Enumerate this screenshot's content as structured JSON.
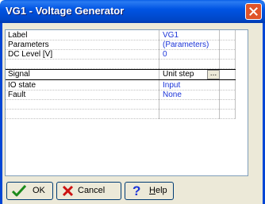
{
  "window": {
    "title": "VG1 - Voltage Generator",
    "close_icon": "close-icon"
  },
  "properties": [
    {
      "name": "Label",
      "value": "VG1"
    },
    {
      "name": "Parameters",
      "value": "(Parameters)"
    },
    {
      "name": "DC Level [V]",
      "value": "0"
    },
    {
      "name": "Signal",
      "value": "Unit step"
    },
    {
      "name": "IO state",
      "value": "Input"
    },
    {
      "name": "Fault",
      "value": "None"
    }
  ],
  "selected_property": "Signal",
  "signal_editor": {
    "ellipsis_label": "..."
  },
  "buttons": {
    "ok": "OK",
    "cancel": "Cancel",
    "help_prefix": "H",
    "help_rest": "elp"
  },
  "colors": {
    "value_text": "#1b34d8",
    "title_bar": "#0054e3",
    "close_button": "#e0542a"
  }
}
